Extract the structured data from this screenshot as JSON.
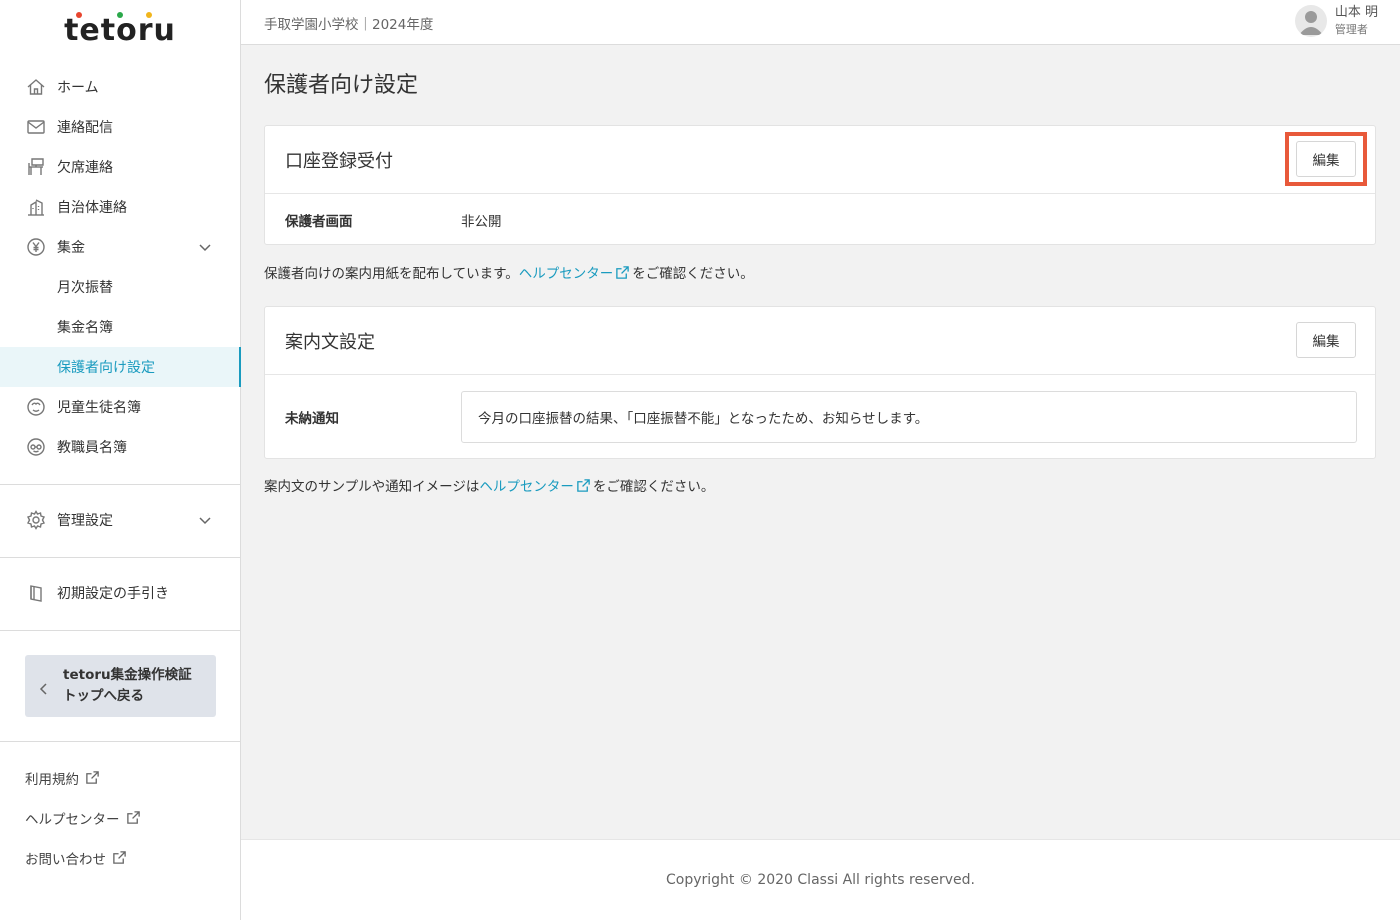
{
  "logo": {
    "text": "tetoru",
    "dot_colors": [
      "#e8452e",
      "#2aa84a",
      "#f1b51c"
    ]
  },
  "sidebar": {
    "items": [
      {
        "label": "ホーム",
        "icon": "home-icon"
      },
      {
        "label": "連絡配信",
        "icon": "mail-icon"
      },
      {
        "label": "欠席連絡",
        "icon": "absence-icon"
      },
      {
        "label": "自治体連絡",
        "icon": "building-icon"
      },
      {
        "label": "集金",
        "icon": "yen-icon"
      },
      {
        "label": "月次振替"
      },
      {
        "label": "集金名簿"
      },
      {
        "label": "保護者向け設定"
      },
      {
        "label": "児童生徒名簿",
        "icon": "student-icon"
      },
      {
        "label": "教職員名簿",
        "icon": "teacher-icon"
      }
    ],
    "admin_settings": "管理設定",
    "setup_guide": "初期設定の手引き",
    "back_button": "tetoru集金操作検証 トップへ戻る",
    "back_button_line1": "tetoru集金操作検証",
    "back_button_line2": "トップへ戻る",
    "footer_links": [
      "利用規約",
      "ヘルプセンター",
      "お問い合わせ"
    ]
  },
  "header": {
    "school": "手取学園小学校｜2024年度",
    "user_name": "山本 明",
    "user_role": "管理者"
  },
  "main": {
    "title": "保護者向け設定",
    "account_card": {
      "title": "口座登録受付",
      "edit_label": "編集",
      "row_label": "保護者画面",
      "row_value": "非公開"
    },
    "note1": {
      "before": "保護者向けの案内用紙を配布しています。",
      "link": "ヘルプセンター",
      "after": "をご確認ください。"
    },
    "guide_card": {
      "title": "案内文設定",
      "edit_label": "編集",
      "row_label": "未納通知",
      "row_value": "今月の口座振替の結果、「口座振替不能」となったため、お知らせします。"
    },
    "note2": {
      "before": "案内文のサンプルや通知イメージは",
      "link": "ヘルプセンター",
      "after": "をご確認ください。"
    }
  },
  "footer": {
    "copyright": "Copyright © 2020 Classi All rights reserved."
  },
  "colors": {
    "accent": "#1a9bbf",
    "highlight": "#e8593a"
  }
}
